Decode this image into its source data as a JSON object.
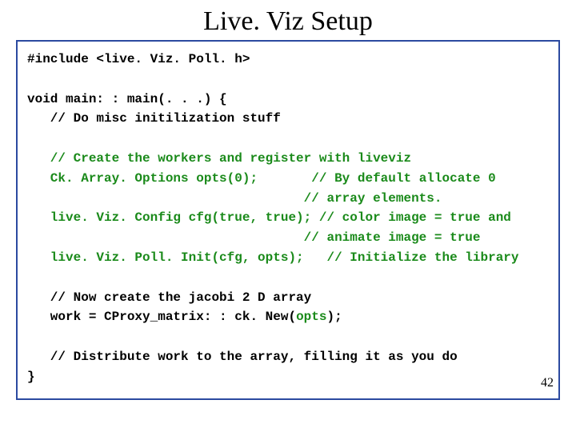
{
  "title": "Live. Viz Setup",
  "code": {
    "l1": "#include <live. Viz. Poll. h>",
    "l2": "",
    "l3": "void main: : main(. . .) {",
    "l4": "   // Do misc initilization stuff",
    "l5": "",
    "l6a": "   // Create the workers and register with liveviz",
    "l7a": "   Ck. Array. Options opts(0);       ",
    "l7b": "// By default allocate 0",
    "l8a": "                                    ",
    "l8b": "// array elements.",
    "l9a": "   live. Viz. Config cfg(true, true); ",
    "l9b": "// color image = true and",
    "l10a": "                                    ",
    "l10b": "// animate image = true",
    "l11a": "   live. Viz. Poll. Init(cfg, opts);   ",
    "l11b": "// Initialize the library",
    "l12": "",
    "l13": "   // Now create the jacobi 2 D array",
    "l14a": "   work = CProxy_matrix: : ck. New(",
    "l14b": "opts",
    "l14c": ");",
    "l15": "",
    "l16": "   // Distribute work to the array, filling it as you do",
    "l17": "}"
  },
  "page_number": "42"
}
